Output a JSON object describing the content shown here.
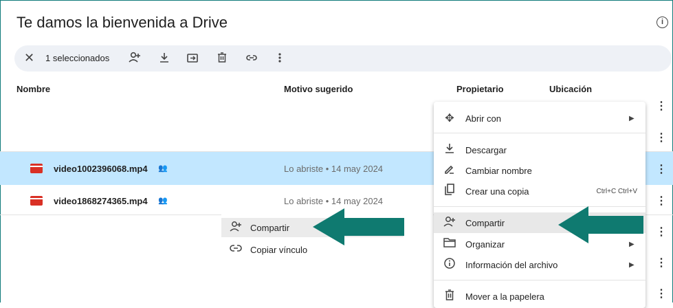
{
  "header": {
    "title": "Te damos la bienvenida a Drive",
    "info_icon": "i"
  },
  "toolbar": {
    "close_glyph": "✕",
    "selection_count": "1 seleccionados",
    "icons": [
      "share-icon",
      "download-icon",
      "move-icon",
      "trash-icon",
      "link-icon",
      "more-icon"
    ]
  },
  "columns": {
    "name": "Nombre",
    "reason": "Motivo sugerido",
    "owner": "Propietario",
    "location": "Ubicación"
  },
  "files": [
    {
      "name": "video1002396068.mp4",
      "reason": "Lo abriste • 14 may 2024",
      "selected": true
    },
    {
      "name": "video1868274365.mp4",
      "reason": "Lo abriste • 14 may 2024",
      "selected": false
    }
  ],
  "context_menu": {
    "items": [
      {
        "label": "Abrir con",
        "icon": "open-with-icon",
        "submenu": true
      },
      {
        "label": "Descargar",
        "icon": "download-icon"
      },
      {
        "label": "Cambiar nombre",
        "icon": "rename-icon"
      },
      {
        "label": "Crear una copia",
        "icon": "copy-icon",
        "shortcut": "Ctrl+C Ctrl+V"
      },
      {
        "label": "Compartir",
        "icon": "share-icon",
        "highlighted": true
      },
      {
        "label": "Organizar",
        "icon": "folder-icon",
        "submenu": true
      },
      {
        "label": "Información del archivo",
        "icon": "info-icon",
        "submenu": true
      },
      {
        "label": "Mover a la papelera",
        "icon": "trash-icon"
      }
    ]
  },
  "share_submenu": {
    "items": [
      {
        "label": "Compartir",
        "icon": "share-icon",
        "highlighted": true
      },
      {
        "label": "Copiar vínculo",
        "icon": "link-icon"
      }
    ]
  },
  "colors": {
    "selected_row": "#c2e7ff",
    "arrow": "#0f7a70",
    "accent": "#d93025"
  }
}
